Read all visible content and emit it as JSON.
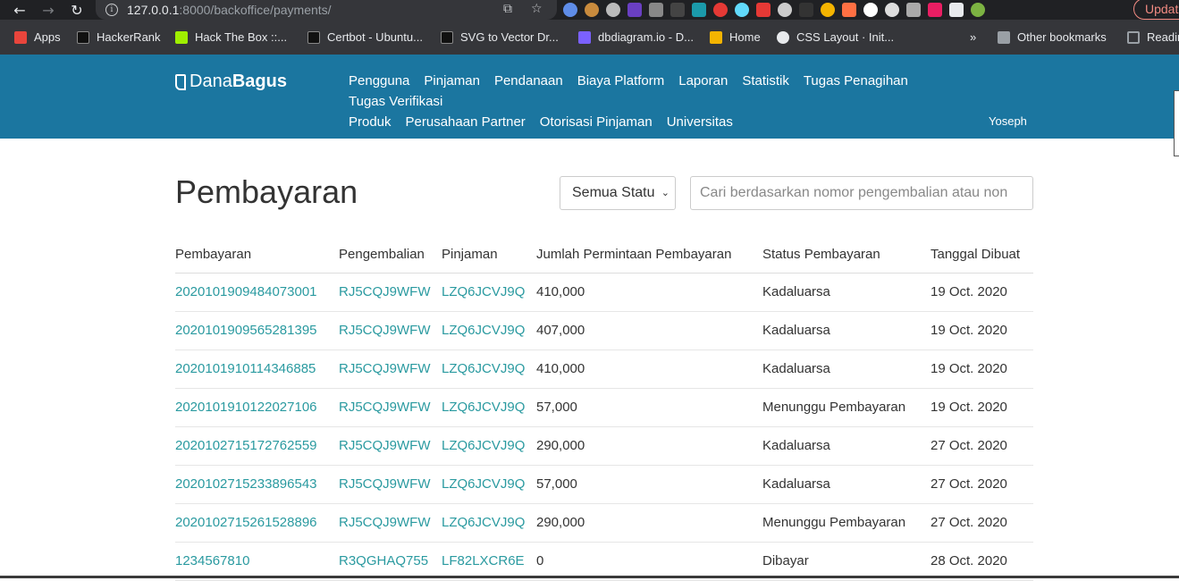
{
  "browser": {
    "url_host": "127.0.0.1",
    "url_rest": ":8000/backoffice/payments/",
    "update_label": "Updat",
    "bookmarks": [
      {
        "label": "Apps",
        "color": "#e8453c"
      },
      {
        "label": "HackerRank",
        "color": "#111"
      },
      {
        "label": "Hack The Box ::...",
        "color": "#9fef00"
      },
      {
        "label": "Certbot - Ubuntu...",
        "color": "#111"
      },
      {
        "label": "SVG to Vector Dr...",
        "color": "#111"
      },
      {
        "label": "dbdiagram.io - D...",
        "color": "#7b61ff"
      },
      {
        "label": "Home",
        "color": "#f4b400"
      },
      {
        "label": "CSS Layout · Init...",
        "color": "#e8eaed"
      },
      {
        "label": "Other bookmarks",
        "color": "#9aa0a6"
      },
      {
        "label": "Readin",
        "color": "#9aa0a6"
      }
    ]
  },
  "header": {
    "logo_light": "Dana",
    "logo_bold": "Bagus",
    "menu": [
      "Pengguna",
      "Pinjaman",
      "Pendanaan",
      "Biaya Platform",
      "Laporan",
      "Statistik",
      "Tugas Penagihan",
      "Tugas Verifikasi",
      "Produk",
      "Perusahaan Partner",
      "Otorisasi Pinjaman",
      "Universitas"
    ],
    "user": "Yoseph",
    "color": "#1b76a0"
  },
  "main": {
    "title": "Pembayaran",
    "status_filter": "Semua Statu",
    "search_placeholder": "Cari berdasarkan nomor pengembalian atau non",
    "columns": [
      "Pembayaran",
      "Pengembalian",
      "Pinjaman",
      "Jumlah Permintaan Pembayaran",
      "Status Pembayaran",
      "Tanggal Dibuat"
    ],
    "rows": [
      [
        "2020101909484073001",
        "RJ5CQJ9WFW",
        "LZQ6JCVJ9Q",
        "410,000",
        "Kadaluarsa",
        "19 Oct. 2020"
      ],
      [
        "2020101909565281395",
        "RJ5CQJ9WFW",
        "LZQ6JCVJ9Q",
        "407,000",
        "Kadaluarsa",
        "19 Oct. 2020"
      ],
      [
        "2020101910114346885",
        "RJ5CQJ9WFW",
        "LZQ6JCVJ9Q",
        "410,000",
        "Kadaluarsa",
        "19 Oct. 2020"
      ],
      [
        "2020101910122027106",
        "RJ5CQJ9WFW",
        "LZQ6JCVJ9Q",
        "57,000",
        "Menunggu Pembayaran",
        "19 Oct. 2020"
      ],
      [
        "2020102715172762559",
        "RJ5CQJ9WFW",
        "LZQ6JCVJ9Q",
        "290,000",
        "Kadaluarsa",
        "27 Oct. 2020"
      ],
      [
        "2020102715233896543",
        "RJ5CQJ9WFW",
        "LZQ6JCVJ9Q",
        "57,000",
        "Kadaluarsa",
        "27 Oct. 2020"
      ],
      [
        "2020102715261528896",
        "RJ5CQJ9WFW",
        "LZQ6JCVJ9Q",
        "290,000",
        "Menunggu Pembayaran",
        "27 Oct. 2020"
      ],
      [
        "1234567810",
        "R3QGHAQ755",
        "LF82LXCR6E",
        "0",
        "Dibayar",
        "28 Oct. 2020"
      ]
    ],
    "link_color": "#2a9aa0"
  }
}
